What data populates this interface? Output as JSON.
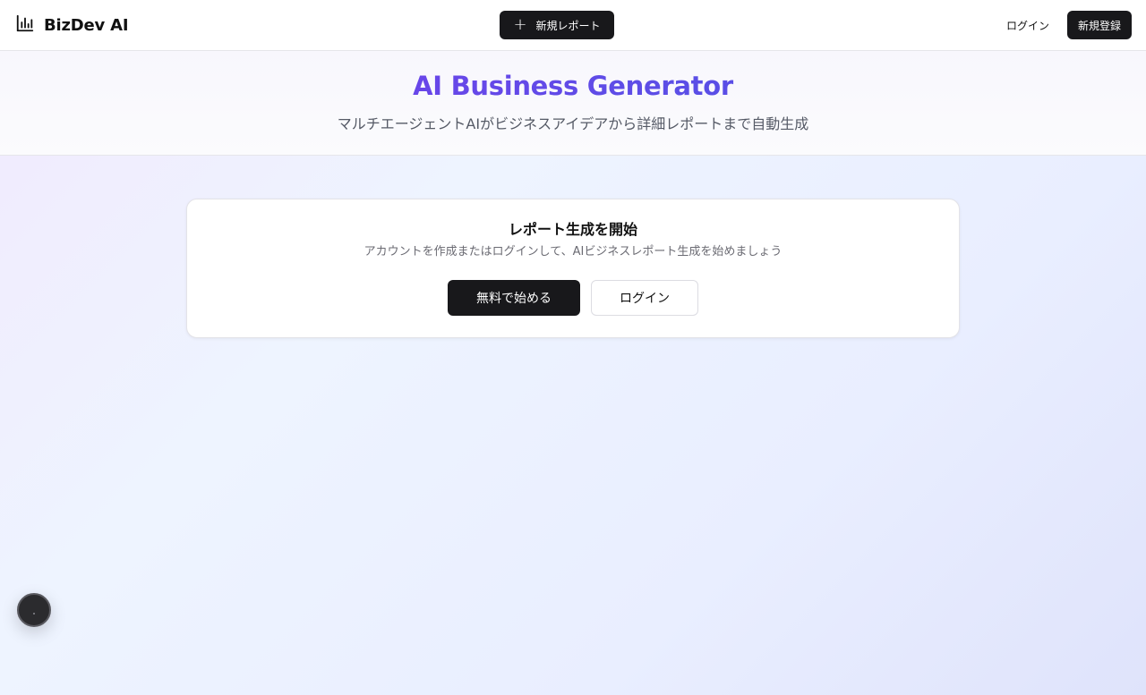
{
  "header": {
    "app_name": "BizDev AI",
    "logo_icon": "bar-chart-icon",
    "new_report_label": "新規レポート",
    "login_label": "ログイン",
    "signup_label": "新規登録"
  },
  "hero": {
    "title": "AI Business Generator",
    "subtitle": "マルチエージェントAIがビジネスアイデアから詳細レポートまで自動生成"
  },
  "card": {
    "title": "レポート生成を開始",
    "description": "アカウントを作成またはログインして、AIビジネスレポート生成を始めましょう",
    "start_label": "無料で始める",
    "login_label": "ログイン"
  },
  "colors": {
    "accent_gradient_start": "#7c3aed",
    "accent_gradient_end": "#4f46e5",
    "primary_button": "#18181b"
  }
}
